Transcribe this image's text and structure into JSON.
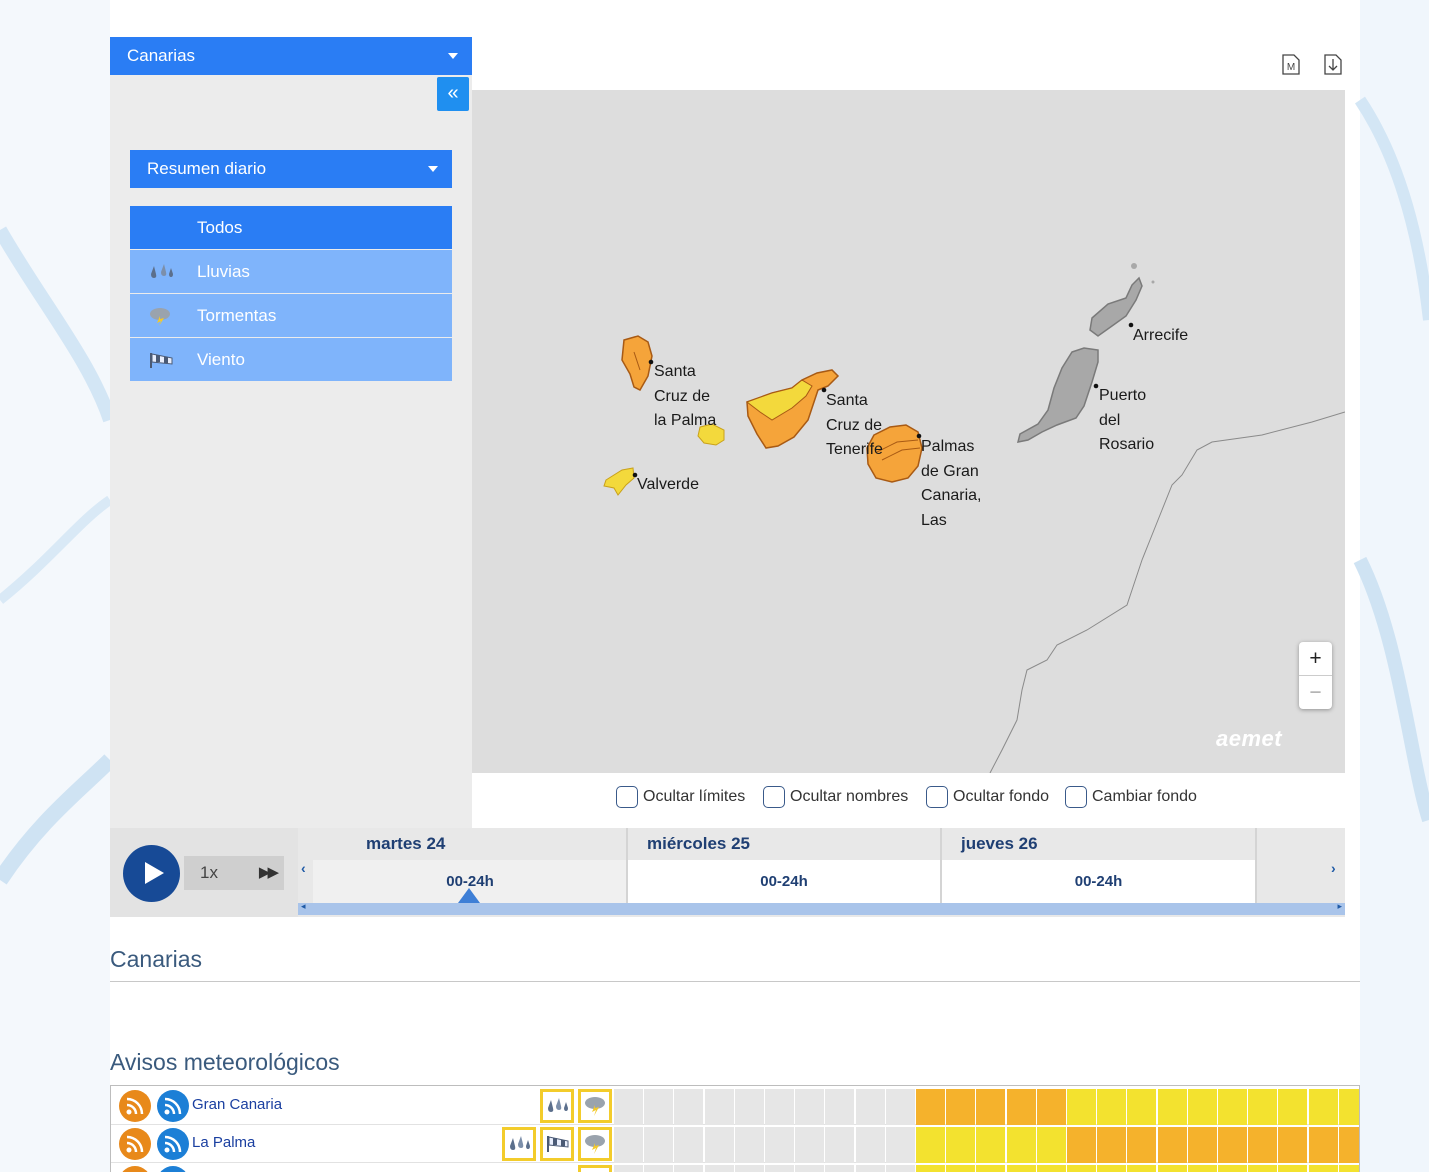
{
  "region_select": {
    "label": "Canarias"
  },
  "collapse_button": {
    "label": "«"
  },
  "summary_select": {
    "label": "Resumen diario"
  },
  "filters": [
    {
      "label": "Todos",
      "icon": "",
      "active": true
    },
    {
      "label": "Lluvias",
      "icon": "rain-icon",
      "active": false
    },
    {
      "label": "Tormentas",
      "icon": "storm-icon",
      "active": false
    },
    {
      "label": "Viento",
      "icon": "wind-icon",
      "active": false
    }
  ],
  "toolbar": {
    "icons": [
      "map-document-icon",
      "download-icon"
    ],
    "map_doc_letter": "M"
  },
  "map": {
    "places": [
      {
        "name": "Santa\nCruz de\nla Palma"
      },
      {
        "name": "Valverde"
      },
      {
        "name": "Santa\nCruz de\nTenerife"
      },
      {
        "name": "Palmas\nde Gran\nCanaria,\nLas"
      },
      {
        "name": "Arrecife"
      },
      {
        "name": "Puerto\ndel\nRosario"
      }
    ],
    "zoom_in": "+",
    "zoom_out": "−",
    "logo": "aemet",
    "colors": {
      "orange": "#f5a43a",
      "yellow": "#f3e03b",
      "gray": "#a8a8a8"
    }
  },
  "map_options": [
    {
      "label": "Ocultar límites",
      "checked": false
    },
    {
      "label": "Ocultar nombres",
      "checked": false
    },
    {
      "label": "Ocultar fondo",
      "checked": false
    },
    {
      "label": "Cambiar fondo",
      "checked": false
    }
  ],
  "player": {
    "speed": "1x",
    "fast_forward": "▶▶"
  },
  "timeline": {
    "days": [
      {
        "name": "martes 24",
        "slot": "00-24h",
        "selected": true
      },
      {
        "name": "miércoles 25",
        "slot": "00-24h",
        "selected": false
      },
      {
        "name": "jueves 26",
        "slot": "00-24h",
        "selected": false
      }
    ]
  },
  "section": {
    "title": "Canarias"
  },
  "warnings": {
    "title": "Avisos meteorológicos",
    "rows": [
      {
        "zone": "Gran Canaria",
        "icons": [
          "rain-icon",
          "storm-icon"
        ],
        "levels": [
          "g",
          "g",
          "g",
          "g",
          "g",
          "g",
          "g",
          "g",
          "g",
          "g",
          "o",
          "o",
          "o",
          "o",
          "o",
          "y",
          "y",
          "y",
          "y",
          "y",
          "y",
          "y",
          "y",
          "y",
          "y",
          "y",
          "y",
          "y"
        ]
      },
      {
        "zone": "La Palma",
        "icons": [
          "rain-icon",
          "wind-icon",
          "storm-icon"
        ],
        "levels": [
          "g",
          "g",
          "g",
          "g",
          "g",
          "g",
          "g",
          "g",
          "g",
          "g",
          "y",
          "y",
          "y",
          "y",
          "y",
          "o",
          "o",
          "o",
          "o",
          "o",
          "o",
          "o",
          "o",
          "o",
          "o",
          "o",
          "o",
          "o"
        ]
      },
      {
        "zone": "",
        "icons": [
          "storm-icon"
        ],
        "levels": [
          "g",
          "g",
          "g",
          "g",
          "g",
          "g",
          "g",
          "g",
          "g",
          "g",
          "y",
          "y",
          "y",
          "y",
          "y",
          "y",
          "y",
          "y",
          "y",
          "y",
          "y",
          "y",
          "y",
          "y",
          "y",
          "y",
          "y",
          "y"
        ]
      }
    ],
    "level_colors": {
      "g": "#e6e6e6",
      "o": "#f5b22c",
      "y": "#f3e22f"
    }
  }
}
